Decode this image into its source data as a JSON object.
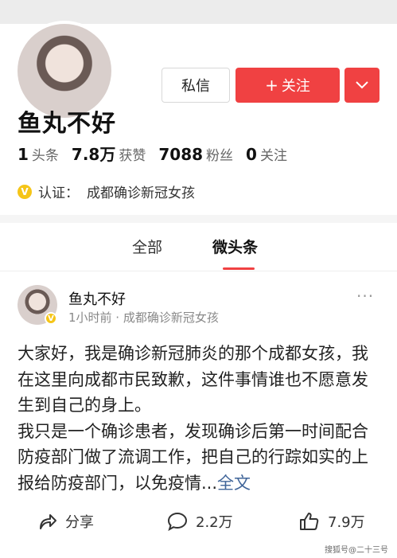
{
  "profile": {
    "name": "鱼丸不好",
    "message_button": "私信",
    "follow_button": "关注",
    "follow_plus": "+",
    "stats": [
      {
        "num": "1",
        "label": "头条"
      },
      {
        "num": "7.8万",
        "label": "获赞"
      },
      {
        "num": "7088",
        "label": "粉丝"
      },
      {
        "num": "0",
        "label": "关注"
      }
    ],
    "verified_prefix": "认证：",
    "verified_text": "成都确诊新冠女孩",
    "verified_badge": "V"
  },
  "tabs": [
    {
      "label": "全部",
      "active": false
    },
    {
      "label": "微头条",
      "active": true
    }
  ],
  "post": {
    "author": "鱼丸不好",
    "meta": "1小时前 · 成都确诊新冠女孩",
    "more": "···",
    "paragraph1": "大家好，我是确诊新冠肺炎的那个成都女孩，我在这里向成都市民致歉，这件事情谁也不愿意发生到自己的身上。",
    "paragraph2": "我只是一个确诊患者，发现确诊后第一时间配合防疫部门做了流调工作，把自己的行踪如实的上报给防疫部门，以免疫情...",
    "read_more": "全文"
  },
  "actions": {
    "share": "分享",
    "comments": "2.2万",
    "likes": "7.9万"
  },
  "watermark": "搜狐号@二十三号",
  "colors": {
    "accent": "#f04142",
    "badge": "#f5c518",
    "link": "#406599"
  }
}
